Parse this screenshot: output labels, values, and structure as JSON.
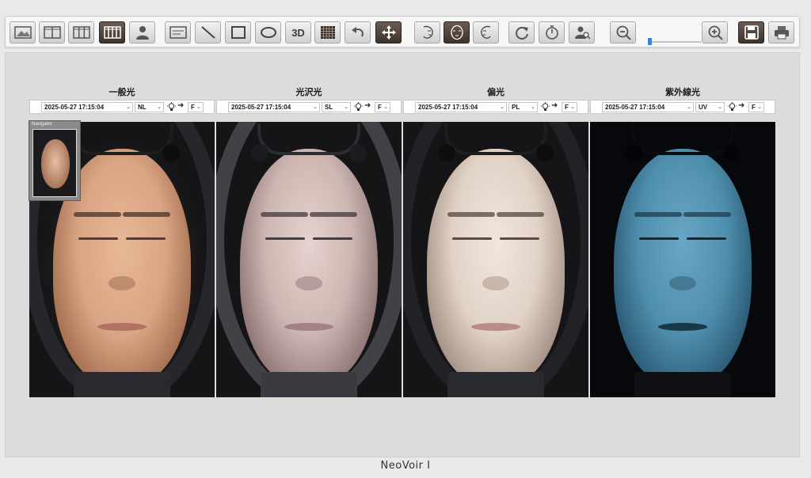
{
  "toolbar": {
    "buttons": [
      {
        "icon": "image-icon"
      },
      {
        "icon": "two-column-layout-icon"
      },
      {
        "icon": "three-column-layout-icon"
      },
      {
        "icon": "four-column-layout-icon",
        "selected": true
      },
      {
        "icon": "user-profile-icon"
      },
      {
        "icon": "text-annotation-icon"
      },
      {
        "icon": "line-tool-icon"
      },
      {
        "icon": "rectangle-tool-icon"
      },
      {
        "icon": "ellipse-tool-icon"
      },
      {
        "icon": "3d-view-icon",
        "label": "3D"
      },
      {
        "icon": "grid-icon"
      },
      {
        "icon": "undo-icon"
      },
      {
        "icon": "move-icon",
        "selected": true
      },
      {
        "icon": "face-left-icon"
      },
      {
        "icon": "face-front-icon",
        "selected": true
      },
      {
        "icon": "face-right-icon"
      },
      {
        "icon": "rotate-icon"
      },
      {
        "icon": "timer-icon"
      },
      {
        "icon": "user-search-icon"
      },
      {
        "icon": "zoom-out-icon"
      },
      {
        "icon": "zoom-in-icon"
      },
      {
        "icon": "save-icon",
        "selected": true
      },
      {
        "icon": "print-icon"
      }
    ],
    "zoom_level": 0
  },
  "panels": [
    {
      "title": "一般光",
      "datetime": "2025-05-27 17:15:04",
      "mode": "NL",
      "face": "F",
      "arrow": "➜"
    },
    {
      "title": "光沢光",
      "datetime": "2025-05-27 17:15:04",
      "mode": "SL",
      "face": "F",
      "arrow": "➜"
    },
    {
      "title": "偏光",
      "datetime": "2025-05-27 17:15:04",
      "mode": "PL",
      "face": "F",
      "arrow": "➜"
    },
    {
      "title": "紫外線光",
      "datetime": "2025-05-27 17:15:04",
      "mode": "UV",
      "face": "F",
      "arrow": "➜"
    }
  ],
  "navigator": {
    "title": "Navigator"
  },
  "brand": "NeoVoir I",
  "colors": {
    "accent_dark": "#4a3e37",
    "zoom_thumb": "#3d7fd6",
    "skin_normal": "#d9a584",
    "skin_gloss": "#cdb6b2",
    "skin_polar": "#e1d2c6",
    "skin_uv": "#4f8fae"
  }
}
